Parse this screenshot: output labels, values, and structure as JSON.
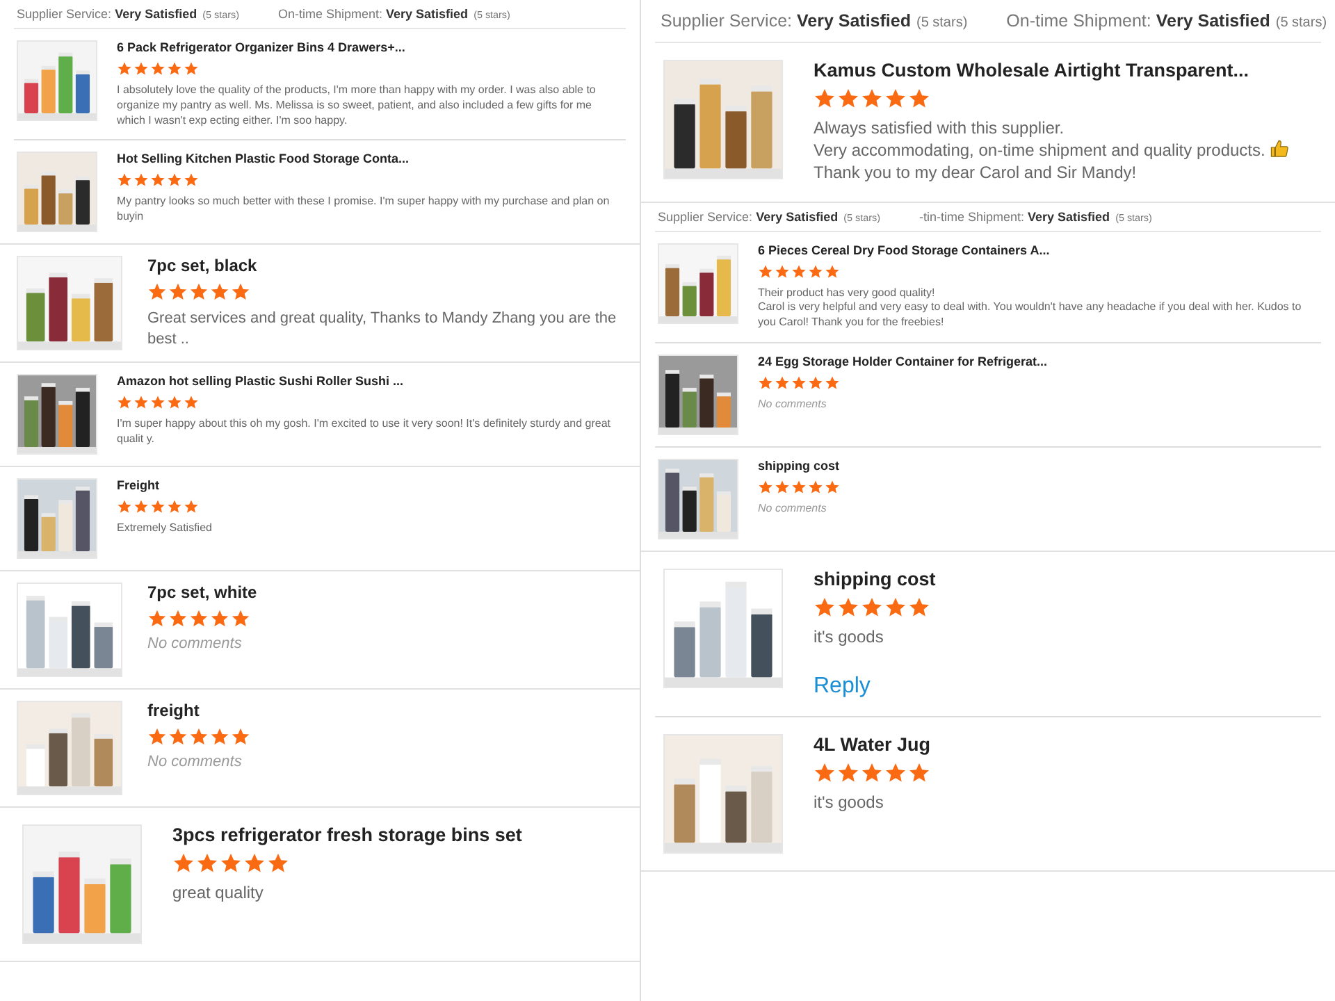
{
  "columns": [
    {
      "snippets": [
        {
          "ratings": [
            {
              "label": "Supplier Service:",
              "value": "Very Satisfied",
              "note": "(5 stars)"
            },
            {
              "label": "On-time Shipment:",
              "value": "Very Satisfied",
              "note": "(5 stars)"
            }
          ],
          "reviews": [
            {
              "title": "6 Pack Refrigerator Organizer Bins 4 Drawers+...",
              "stars": 5,
              "comment": "I absolutely love the quality of the products, I'm more than happy with my order. I was also able to organize my pantry as well. Ms. Melissa is so sweet, patient, and also included a few gifts for me which I wasn't exp ecting either. I'm soo happy."
            },
            {
              "title": "Hot Selling Kitchen Plastic Food Storage Conta...",
              "stars": 5,
              "comment": "My pantry looks so much better with these I promise. I'm super happy with my purchase and plan on buyin"
            }
          ]
        },
        {
          "reviews": [
            {
              "title": "7pc set, black",
              "stars": 5,
              "comment": "Great services and great quality, Thanks to Mandy Zhang you are the best .."
            }
          ]
        },
        {
          "reviews": [
            {
              "title": "Amazon hot selling Plastic Sushi Roller Sushi ...",
              "stars": 5,
              "comment": "I'm super happy about this oh my gosh. I'm excited to use it very soon! It's definitely sturdy and great qualit y."
            }
          ]
        },
        {
          "reviews": [
            {
              "title": "Freight",
              "stars": 5,
              "comment": "Extremely Satisfied"
            }
          ]
        },
        {
          "reviews": [
            {
              "title": "7pc set, white",
              "stars": 5,
              "no_comment": "No comments"
            }
          ]
        },
        {
          "reviews": [
            {
              "title": "freight",
              "stars": 5,
              "no_comment": "No comments"
            }
          ]
        },
        {
          "reviews": [
            {
              "title": "3pcs refrigerator fresh storage bins set",
              "stars": 5,
              "comment": "great quality"
            }
          ]
        }
      ]
    },
    {
      "snippets": [
        {
          "ratings": [
            {
              "label": "Supplier Service:",
              "value": "Very Satisfied",
              "note": "(5 stars)"
            },
            {
              "label": "On-time Shipment:",
              "value": "Very Satisfied",
              "note": "(5 stars)"
            }
          ],
          "reviews": [
            {
              "title": "Kamus Custom Wholesale Airtight Transparent...",
              "stars": 5,
              "comment": "Always satisfied with this supplier.\nVery accommodating, on-time shipment and quality products.",
              "thumbs_up": true,
              "comment_end": "Thank you to my dear Carol and Sir Mandy!"
            }
          ]
        },
        {
          "ratings": [
            {
              "label": "Supplier Service:",
              "value": "Very Satisfied",
              "note": "(5 stars)"
            },
            {
              "label": "-tin-time Shipment:",
              "value": "Very Satisfied",
              "note": "(5 stars)"
            }
          ],
          "reviews": [
            {
              "title": "6 Pieces Cereal Dry Food Storage Containers A...",
              "stars": 5,
              "comment": "Their product has very good quality!\nCarol is very helpful and very easy to deal with. You wouldn't have any headache if you deal with her. Kudos to you Carol! Thank you for the freebies!"
            },
            {
              "title": "24 Egg Storage Holder Container for Refrigerat...",
              "stars": 5,
              "no_comment": "No comments"
            },
            {
              "title": "shipping cost",
              "stars": 5,
              "no_comment": "No comments"
            }
          ]
        },
        {
          "reviews": [
            {
              "title": "shipping cost",
              "stars": 5,
              "comment": "it's goods",
              "reply": "Reply"
            },
            {
              "title": "4L Water Jug",
              "stars": 5,
              "comment": "it's goods"
            }
          ]
        }
      ]
    }
  ]
}
